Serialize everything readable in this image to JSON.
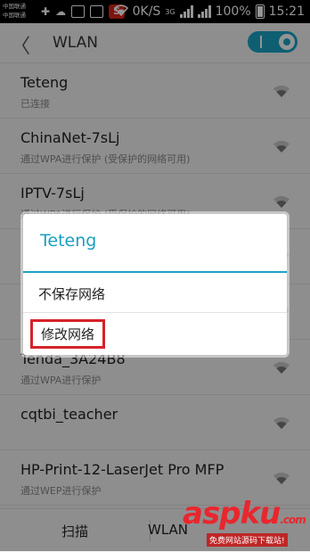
{
  "status_bar": {
    "carrier_lines": [
      "中国联通",
      "中国联通"
    ],
    "net_speed": "0K/S",
    "network_type": "3G",
    "battery": "100%",
    "time": "15:21"
  },
  "header": {
    "title": "WLAN",
    "wlan_enabled": true
  },
  "networks": [
    {
      "ssid": "Teteng",
      "status": "已连接"
    },
    {
      "ssid": "ChinaNet-7sLj",
      "status": "通过WPA进行保护 (受保护的网络可用)"
    },
    {
      "ssid": "IPTV-7sLj",
      "status": "通过WPA进行保护 (受保护的网络可用)"
    },
    {
      "ssid": "",
      "status": ""
    },
    {
      "ssid": "",
      "status": ""
    },
    {
      "ssid": "Tenda_3A24B8",
      "status": "通过WPA进行保护"
    },
    {
      "ssid": "cqtbi_teacher",
      "status": ""
    },
    {
      "ssid": "HP-Print-12-LaserJet Pro MFP",
      "status": "通过WEP进行保护"
    }
  ],
  "bottom_bar": {
    "scan": "扫描",
    "wifi_direct": "WLAN"
  },
  "dialog": {
    "title": "Teteng",
    "options": [
      "不保存网络",
      "修改网络"
    ],
    "highlighted_option": "修改网络",
    "accent_color": "#1aa4c6",
    "highlight_color": "#d6222a"
  },
  "watermark": {
    "brand": "aspku",
    "suffix": ".com",
    "caption": "免费网站源码下载站!"
  }
}
